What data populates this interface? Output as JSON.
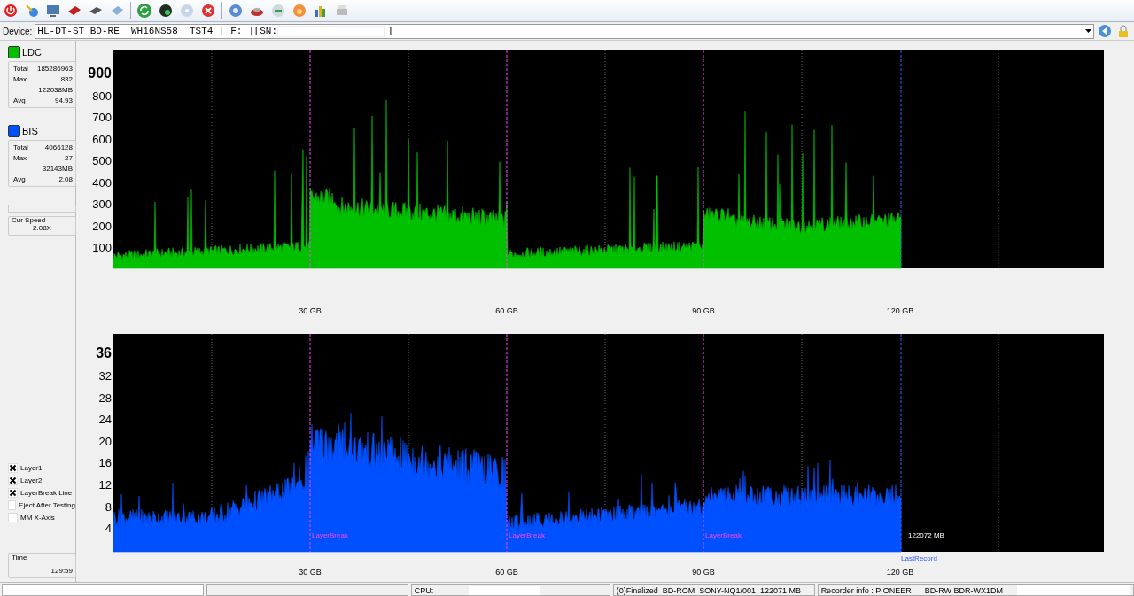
{
  "device": {
    "label": "Device:",
    "value": "HL-DT-ST BD-RE  WH16NS58  TST4 [ F: ][SN:",
    "value_end": "]"
  },
  "stats_panels": [
    {
      "legend": "LDC",
      "color": "#00c000",
      "stats": [
        {
          "label": "Total",
          "value": "185286963"
        },
        {
          "label": "Max",
          "value": "832"
        },
        {
          "value": "122038MB"
        },
        {
          "label": "Avg",
          "value": "94.93"
        }
      ]
    },
    {
      "legend": "BIS",
      "color": "#0050ff",
      "stats": [
        {
          "label": "Total",
          "value": "4066128"
        },
        {
          "label": "Max",
          "value": "27"
        },
        {
          "value": "32143MB"
        },
        {
          "label": "Avg",
          "value": "2.08"
        }
      ]
    }
  ],
  "cur_speed": {
    "label": "Cur Speed",
    "value": "2.08X"
  },
  "options": [
    {
      "label": "Layer1",
      "checked": true
    },
    {
      "label": "Layer2",
      "checked": true
    },
    {
      "label": "LayerBreak Line",
      "checked": true
    },
    {
      "label": "Eject After Testing",
      "checked": false
    },
    {
      "label": "MM X-Axis",
      "checked": false
    }
  ],
  "time": {
    "label": "Time",
    "value": "129:59"
  },
  "charts": [
    {
      "kind": "ldc",
      "y_ticks": [
        "900",
        "800",
        "700",
        "600",
        "500",
        "400",
        "300",
        "200",
        "100"
      ],
      "x_ticks": [
        "30 GB",
        "60 GB",
        "90 GB",
        "120 GB"
      ]
    },
    {
      "kind": "bis",
      "y_ticks": [
        "36",
        "32",
        "28",
        "24",
        "20",
        "16",
        "12",
        "8",
        "4"
      ],
      "x_ticks": [
        "30 GB",
        "60 GB",
        "90 GB",
        "120 GB"
      ],
      "layer_break_labels": [
        "LayerBreak",
        "LayerBreak",
        "LayerBreak"
      ],
      "end_reading": "122072 MB",
      "end_label": "LastRecord"
    }
  ],
  "status_bar": {
    "cpu_label": "CPU:",
    "disc_info": "(0)Finalized  BD-ROM  SONY-NQ1/001  122071 MB",
    "recorder_info": "Recorder info : PIONEER      BD-RW BDR-WX1DM"
  }
}
